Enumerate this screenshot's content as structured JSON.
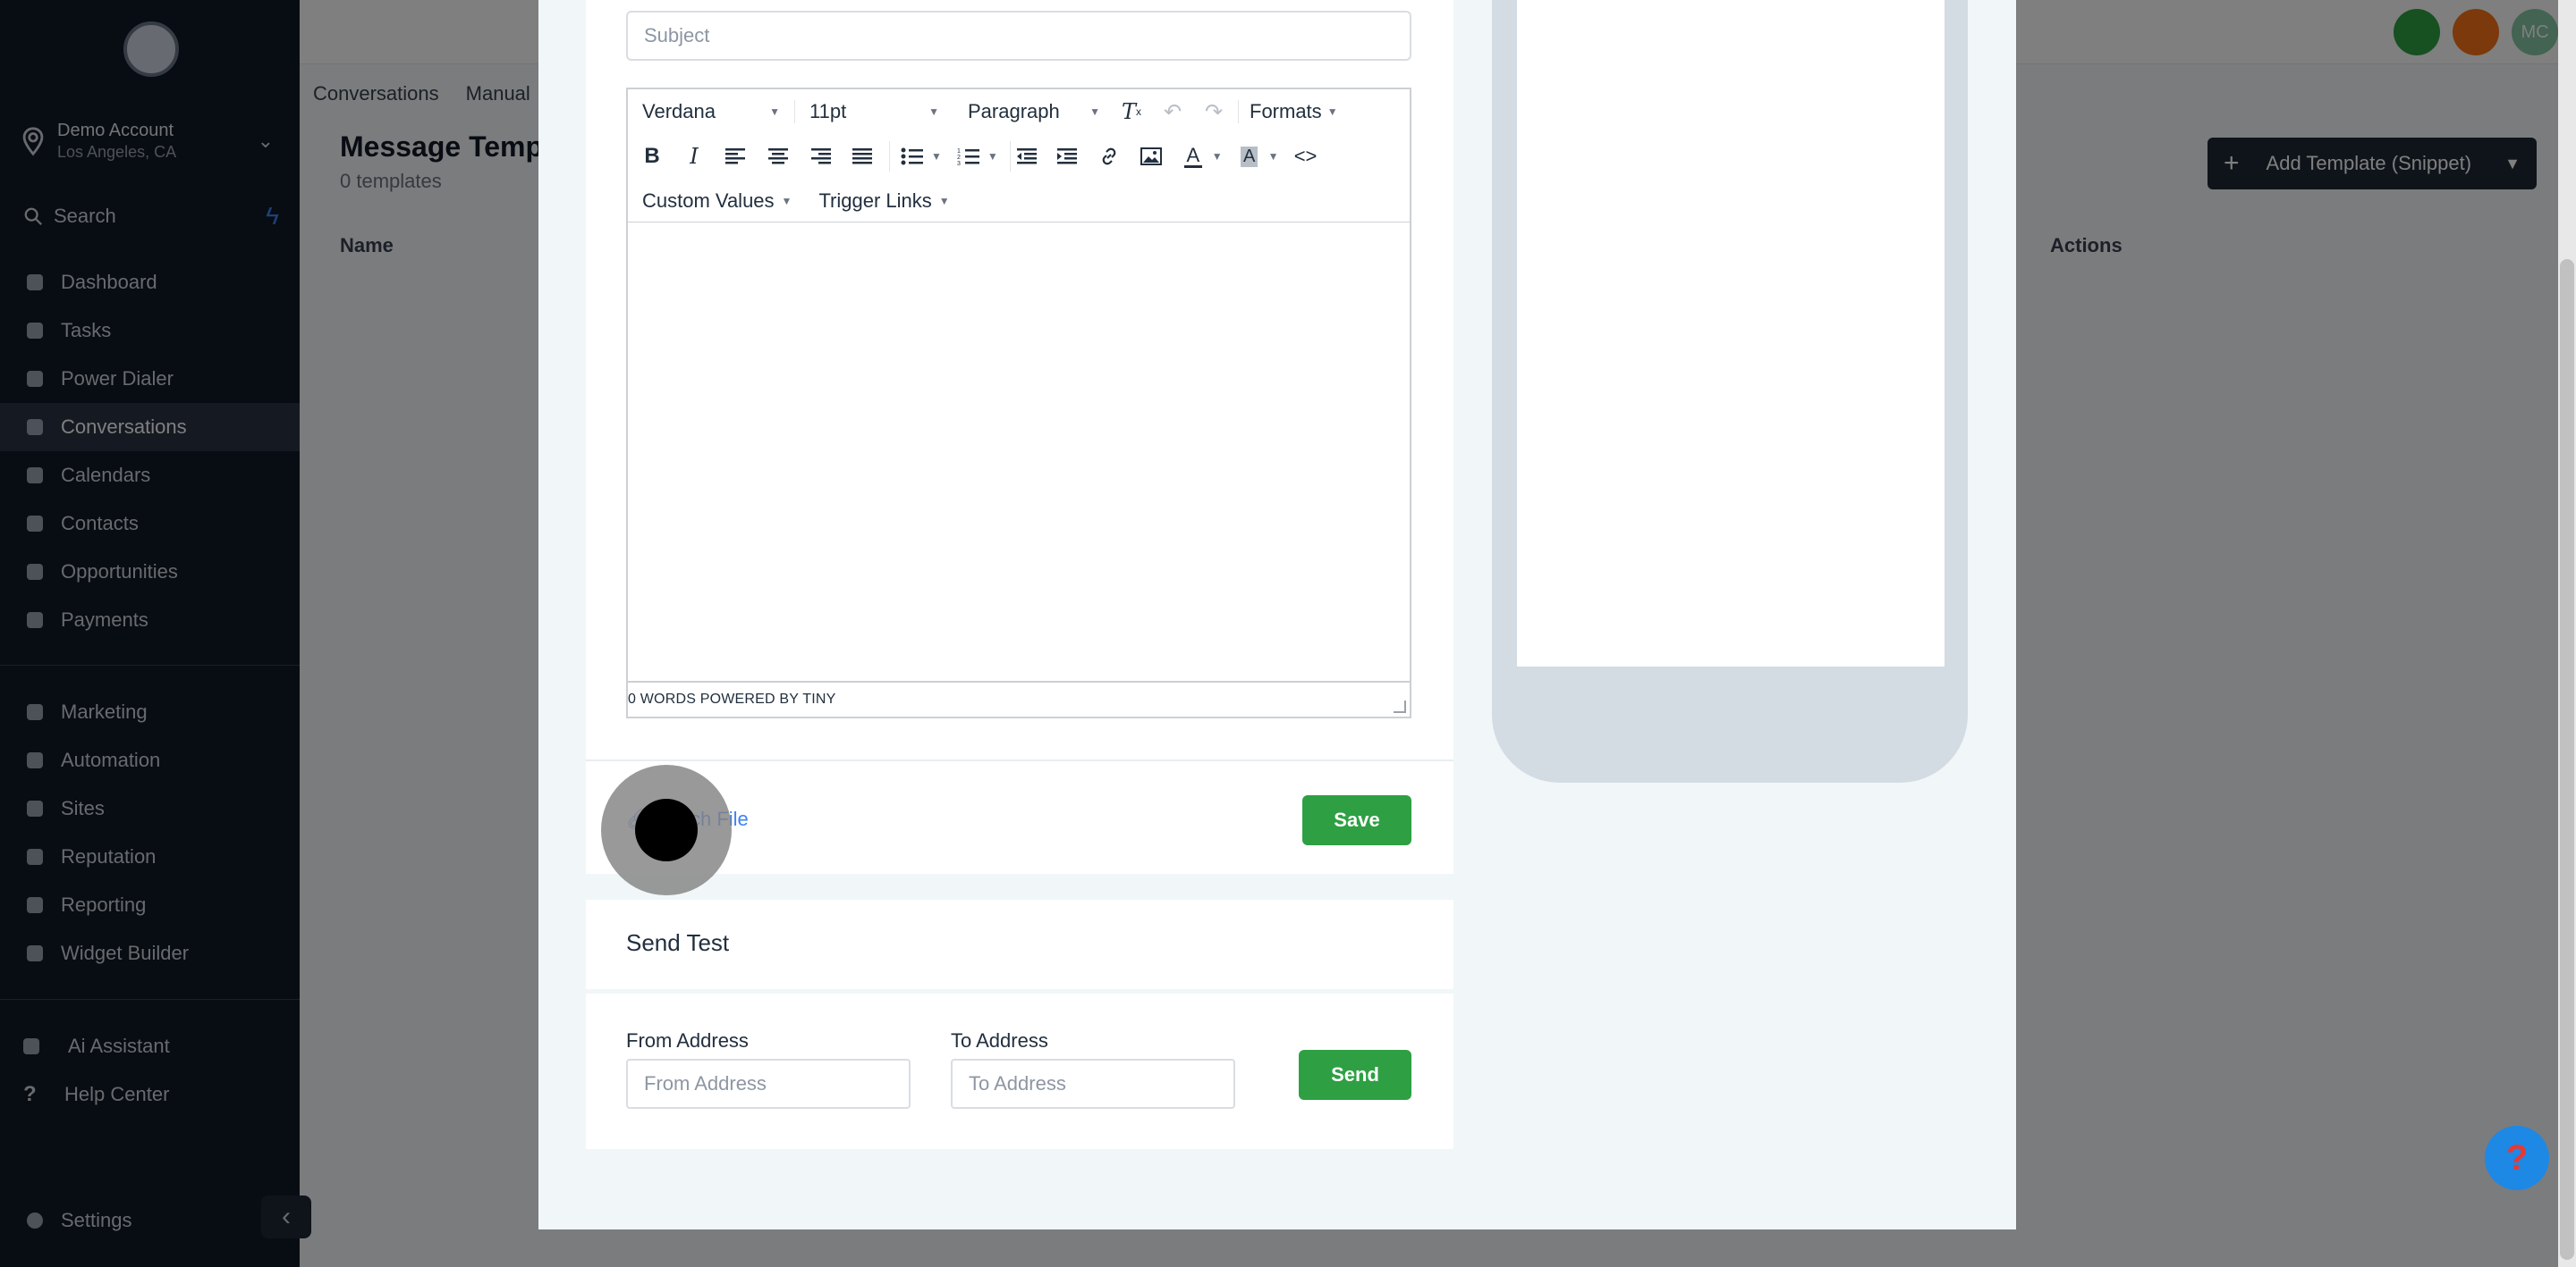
{
  "sidebar": {
    "account_name": "Demo Account",
    "account_location": "Los Angeles, CA",
    "search_label": "Search",
    "nav_primary": [
      {
        "label": "Dashboard",
        "active": false
      },
      {
        "label": "Tasks",
        "active": false
      },
      {
        "label": "Power Dialer",
        "active": false
      },
      {
        "label": "Conversations",
        "active": true
      },
      {
        "label": "Calendars",
        "active": false
      },
      {
        "label": "Contacts",
        "active": false
      },
      {
        "label": "Opportunities",
        "active": false
      },
      {
        "label": "Payments",
        "active": false
      }
    ],
    "nav_secondary": [
      {
        "label": "Marketing"
      },
      {
        "label": "Automation"
      },
      {
        "label": "Sites"
      },
      {
        "label": "Reputation"
      },
      {
        "label": "Reporting"
      },
      {
        "label": "Widget Builder"
      }
    ],
    "nav_tertiary": [
      {
        "label": "Ai Assistant"
      },
      {
        "label": "Help Center"
      }
    ],
    "settings_label": "Settings"
  },
  "header": {
    "avatar_initials": "MC",
    "subnav": [
      "Conversations",
      "Manual"
    ],
    "page_title": "Message Temp",
    "page_subtitle": "0 templates",
    "add_button": "Add Template (Snippet)",
    "columns": {
      "name": "Name",
      "actions": "Actions"
    }
  },
  "modal": {
    "subject_placeholder": "Subject",
    "editor": {
      "font_family": "Verdana",
      "font_size": "11pt",
      "block_format": "Paragraph",
      "formats_menu": "Formats",
      "custom_values_menu": "Custom Values",
      "trigger_links_menu": "Trigger Links",
      "status_text": "0 WORDS POWERED BY TINY"
    },
    "attach_file_label": "Attach File",
    "save_label": "Save",
    "send_test": {
      "title": "Send Test",
      "from_label": "From Address",
      "from_placeholder": "From Address",
      "to_label": "To Address",
      "to_placeholder": "To Address",
      "send_label": "Send"
    }
  },
  "colors": {
    "primary_green": "#2ea043",
    "link_blue": "#3b82f6",
    "sidebar_bg": "#111827"
  }
}
